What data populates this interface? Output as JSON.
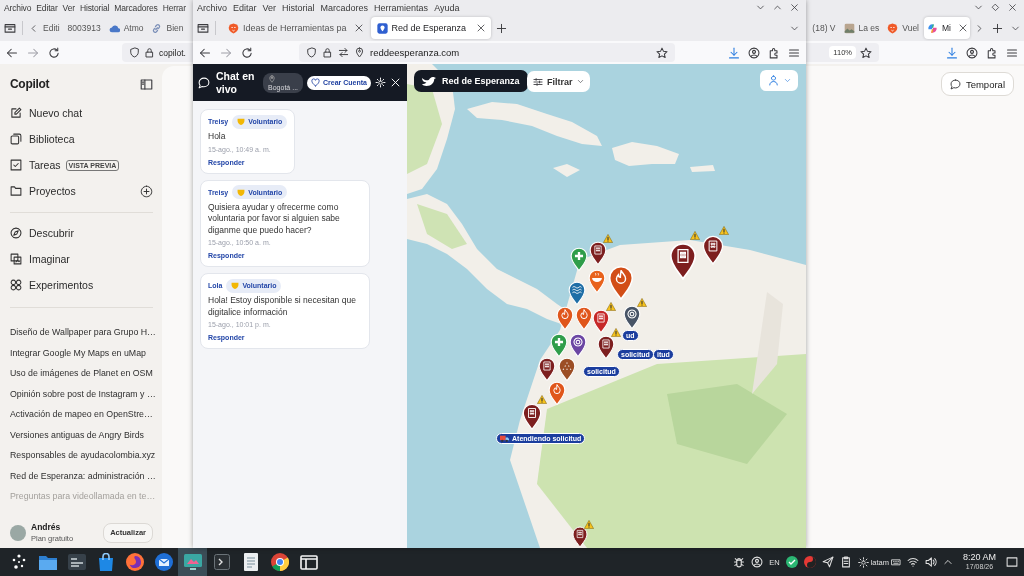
{
  "back_window": {
    "menu": [
      "Archivo",
      "Editar",
      "Ver",
      "Historial",
      "Marcadores",
      "Herrar"
    ],
    "tabs_left": [
      {
        "label": "Editi",
        "kind": "none",
        "selected": false,
        "closable": false
      },
      {
        "label": "8003913",
        "kind": "none",
        "selected": false,
        "closable": false
      },
      {
        "label": "Atmo",
        "kind": "cloud",
        "selected": false,
        "closable": false
      },
      {
        "label": "Bien",
        "kind": "link",
        "selected": false,
        "closable": false
      }
    ],
    "tabs_right": [
      {
        "label": "(18) V",
        "kind": "none",
        "selected": false,
        "closable": false
      },
      {
        "label": "La es",
        "kind": "photo",
        "selected": false,
        "closable": false
      },
      {
        "label": "Vuel",
        "kind": "lion",
        "selected": false,
        "closable": false
      },
      {
        "label": "Mi",
        "kind": "swirl",
        "selected": true,
        "closable": true
      }
    ],
    "url": "copilot.",
    "zoom": "110%"
  },
  "copilot": {
    "title": "Copilot",
    "nav": [
      {
        "label": "Nuevo chat",
        "kind": "compose",
        "add_button": false
      },
      {
        "label": "Biblioteca",
        "kind": "library",
        "add_button": false
      },
      {
        "label": "Tareas",
        "kind": "tasks",
        "badge": "VISTA PREVIA",
        "add_button": false
      },
      {
        "label": "Proyectos",
        "kind": "folder",
        "add_button": true
      }
    ],
    "explore": [
      {
        "label": "Descubrir",
        "kind": "discover"
      },
      {
        "label": "Imaginar",
        "kind": "imagine"
      },
      {
        "label": "Experimentos",
        "kind": "labs"
      }
    ],
    "history": [
      {
        "title": "Diseño de Wallpaper para Grupo H…",
        "faded": false
      },
      {
        "title": "Integrar Google My Maps en uMap",
        "faded": false
      },
      {
        "title": "Uso de imágenes de Planet en OSM",
        "faded": false
      },
      {
        "title": "Opinión sobre post de Instagram y …",
        "faded": false
      },
      {
        "title": "Activación de mapeo en OpenStre…",
        "faded": false
      },
      {
        "title": "Versiones antiguas de Angry Birds",
        "faded": false
      },
      {
        "title": "Responsables de ayudacolombia.xyz",
        "faded": false
      },
      {
        "title": "Red de Esperanza: administración …",
        "faded": false
      },
      {
        "title": "Preguntas para videollamada en te…",
        "faded": true
      }
    ],
    "user": {
      "name": "Andrés",
      "plan": "Plan gratuito"
    },
    "upgrade": "Actualizar",
    "temporal": "Temporal"
  },
  "front_window": {
    "menu": [
      "Archivo",
      "Editar",
      "Ver",
      "Historial",
      "Marcadores",
      "Herramientas",
      "Ayuda"
    ],
    "tabs": [
      {
        "label": "Ideas de Herramientas pa",
        "kind": "lion",
        "selected": false,
        "closable": true
      },
      {
        "label": "Red de Esperanza",
        "kind": "pin",
        "selected": true,
        "closable": true
      }
    ],
    "url": "reddeesperanza.com"
  },
  "chat": {
    "title": "Chat en vivo",
    "location": "Bogotá ...",
    "create_account": "Crear Cuenta",
    "messages": [
      {
        "author": "Treisy",
        "role": "Voluntario",
        "text": "Hola",
        "time": "15-ago., 10:49 a. m.",
        "reply": "Responder"
      },
      {
        "author": "Treisy",
        "role": "Voluntario",
        "text": "Quisiera ayudar y ofrecerme como voluntaria por favor si alguien sabe diganme que puedo hacer?",
        "time": "15-ago., 10:50 a. m.",
        "reply": "Responder"
      },
      {
        "author": "Lola",
        "role": "Voluntario",
        "text": "Hola! Estoy disponible si necesitan que digitalice información",
        "time": "15-ago., 10:01 p. m.",
        "reply": "Responder"
      }
    ]
  },
  "map": {
    "brand": "Red de Esperanza",
    "filter": "Filtrar",
    "status_labels": [
      "ud",
      "solicitud",
      "itud",
      "solicitud",
      "Atendiendo solicitud"
    ],
    "pins": [
      {
        "kind": "aid",
        "color": "#2f9d4a",
        "alert": false
      },
      {
        "kind": "building",
        "color": "#7d1f1f",
        "alert": true
      },
      {
        "kind": "food",
        "color": "#e8621c",
        "alert": false
      },
      {
        "kind": "fire",
        "color": "#d24e17",
        "alert": false
      },
      {
        "kind": "water",
        "color": "#1f6ea6",
        "alert": false
      },
      {
        "kind": "building",
        "color": "#7d1f1f",
        "alert": true
      },
      {
        "kind": "building",
        "color": "#7d1f1f",
        "alert": true
      },
      {
        "kind": "fire",
        "color": "#e0561b",
        "alert": false
      },
      {
        "kind": "fire",
        "color": "#e0561b",
        "alert": false
      },
      {
        "kind": "building",
        "color": "#c62828",
        "alert": true
      },
      {
        "kind": "aid",
        "color": "#2f9d4a",
        "alert": false
      },
      {
        "kind": "rescue",
        "color": "#6b46a3",
        "alert": false
      },
      {
        "kind": "rescue",
        "color": "#475466",
        "alert": true
      },
      {
        "kind": "building",
        "color": "#7d1f1f",
        "alert": true
      },
      {
        "kind": "building",
        "color": "#7d1f1f",
        "alert": false
      },
      {
        "kind": "supplies",
        "color": "#9c4e25",
        "alert": false
      },
      {
        "kind": "fire",
        "color": "#e0561b",
        "alert": false
      },
      {
        "kind": "building",
        "color": "#7d1f1f",
        "alert": true
      },
      {
        "kind": "building",
        "color": "#7d1f1f",
        "alert": true
      }
    ]
  },
  "taskbar": {
    "apps": [
      {
        "kind": "launcher",
        "active": false
      },
      {
        "kind": "files",
        "active": false
      },
      {
        "kind": "monitor",
        "active": false
      },
      {
        "kind": "store",
        "active": false
      },
      {
        "kind": "fox",
        "active": false
      },
      {
        "kind": "mail",
        "active": false
      },
      {
        "kind": "display",
        "active": true
      },
      {
        "kind": "terminal",
        "active": false
      },
      {
        "kind": "notes",
        "active": false
      },
      {
        "kind": "chrome",
        "active": false
      },
      {
        "kind": "panel",
        "active": false
      }
    ],
    "language": "EN",
    "layout": "latam",
    "time": "8:20 AM",
    "date": "17/08/26"
  }
}
